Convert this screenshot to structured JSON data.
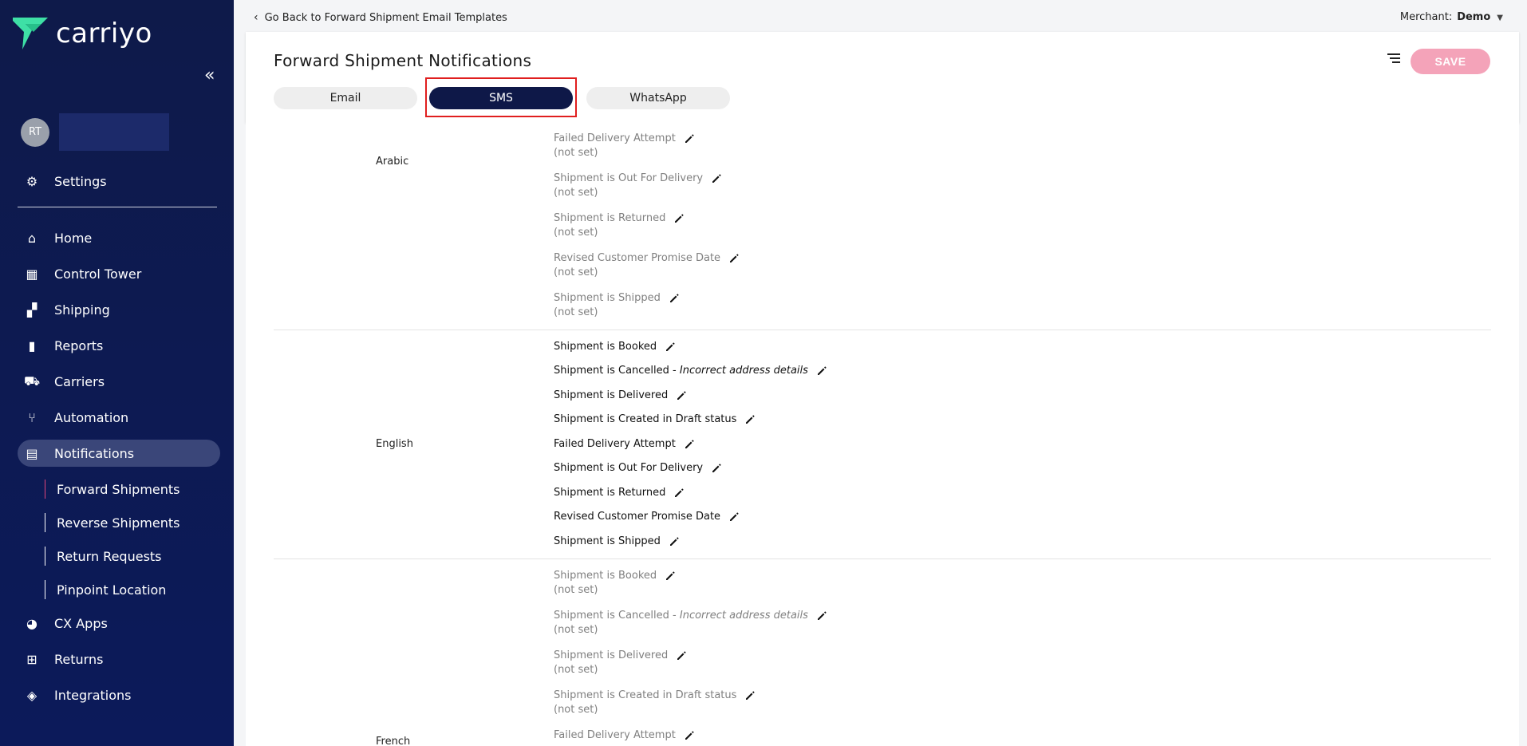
{
  "app": {
    "brand": "carriyo"
  },
  "user": {
    "initials": "RT"
  },
  "sidebar": {
    "settings": "Settings",
    "items": [
      {
        "label": "Home",
        "icon": "home-icon"
      },
      {
        "label": "Control Tower",
        "icon": "dashboard-icon"
      },
      {
        "label": "Shipping",
        "icon": "boxes-icon"
      },
      {
        "label": "Reports",
        "icon": "bar-chart-icon"
      },
      {
        "label": "Carriers",
        "icon": "truck-icon"
      },
      {
        "label": "Automation",
        "icon": "fork-icon"
      },
      {
        "label": "Notifications",
        "icon": "message-icon"
      }
    ],
    "sub_items": [
      "Forward Shipments",
      "Reverse Shipments",
      "Return Requests",
      "Pinpoint Location"
    ],
    "bottom_items": [
      {
        "label": "CX Apps",
        "icon": "palette-icon"
      },
      {
        "label": "Returns",
        "icon": "return-box-icon"
      },
      {
        "label": "Integrations",
        "icon": "layers-icon"
      }
    ]
  },
  "topbar": {
    "back_label": "Go Back to Forward Shipment Email Templates",
    "merchant_label": "Merchant:",
    "merchant_value": "Demo"
  },
  "header": {
    "title": "Forward Shipment Notifications",
    "tabs": [
      "Email",
      "SMS",
      "WhatsApp"
    ],
    "active_tab": "SMS",
    "save_label": "SAVE"
  },
  "not_set": "(not set)",
  "languages": {
    "arabic": {
      "label": "Arabic",
      "templates": [
        "Failed Delivery Attempt",
        "Shipment is Out For Delivery",
        "Shipment is Returned",
        "Revised Customer Promise Date",
        "Shipment is Shipped"
      ]
    },
    "english": {
      "label": "English",
      "templates": [
        "Shipment is Booked",
        "Shipment is Cancelled - ",
        "Shipment is Delivered",
        "Shipment is Created in Draft status",
        "Failed Delivery Attempt",
        "Shipment is Out For Delivery",
        "Shipment is Returned",
        "Revised Customer Promise Date",
        "Shipment is Shipped"
      ],
      "cancel_reason": "Incorrect address details"
    },
    "french": {
      "label": "French",
      "templates": [
        "Shipment is Booked",
        "Shipment is Cancelled - ",
        "Shipment is Delivered",
        "Shipment is Created in Draft status",
        "Failed Delivery Attempt"
      ],
      "cancel_reason": "Incorrect address details"
    }
  },
  "colors": {
    "sidebar_bg": "#0e1a4a",
    "active_tab": "#0e1848",
    "save_button": "#f4a3b9",
    "highlight_border": "#e01e1e",
    "current_sub_marker": "#e0457b"
  }
}
